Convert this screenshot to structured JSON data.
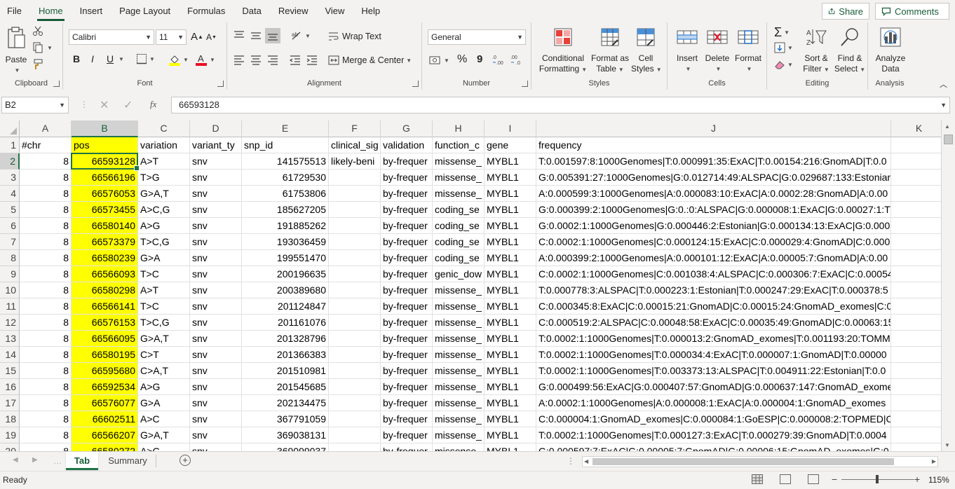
{
  "menu": {
    "tabs": [
      "File",
      "Home",
      "Insert",
      "Page Layout",
      "Formulas",
      "Data",
      "Review",
      "View",
      "Help"
    ],
    "active_tab": "Home",
    "share_label": "Share",
    "comments_label": "Comments"
  },
  "ribbon": {
    "clipboard": {
      "paste": "Paste",
      "label": "Clipboard"
    },
    "font": {
      "name": "Calibri",
      "size": "11",
      "bold": "B",
      "italic": "I",
      "underline": "U",
      "label": "Font"
    },
    "alignment": {
      "wrap_text": "Wrap Text",
      "merge_center": "Merge & Center",
      "label": "Alignment"
    },
    "number": {
      "format": "General",
      "percent": "%",
      "comma": "9",
      "label": "Number"
    },
    "styles": {
      "conditional_1": "Conditional",
      "conditional_2": "Formatting",
      "format_as_1": "Format as",
      "format_as_2": "Table",
      "cell_styles_1": "Cell",
      "cell_styles_2": "Styles",
      "label": "Styles"
    },
    "cells": {
      "insert": "Insert",
      "delete": "Delete",
      "format": "Format",
      "label": "Cells"
    },
    "editing": {
      "sort_1": "Sort &",
      "sort_2": "Filter",
      "find_1": "Find &",
      "find_2": "Select",
      "sigma": "Σ",
      "label": "Editing"
    },
    "analysis": {
      "analyze_1": "Analyze",
      "analyze_2": "Data",
      "label": "Analysis"
    }
  },
  "formula_bar": {
    "name_box": "B2",
    "fx": "fx",
    "value": "66593128"
  },
  "grid": {
    "columns": [
      "A",
      "B",
      "C",
      "D",
      "E",
      "F",
      "G",
      "H",
      "I",
      "J",
      "K"
    ],
    "selected_column": "B",
    "selected_row": "2",
    "rows": [
      {
        "n": "1",
        "cells": [
          "#chr",
          "pos",
          "variation",
          "variant_ty",
          "snp_id",
          "clinical_sig",
          "validation",
          "function_c",
          "gene",
          "frequency",
          ""
        ]
      },
      {
        "n": "2",
        "cells": [
          "8",
          "66593128",
          "A>T",
          "snv",
          "141575513",
          "likely-beni",
          "by-frequer",
          "missense_",
          "MYBL1",
          "T:0.001597:8:1000Genomes|T:0.000991:35:ExAC|T:0.00154:216:GnomAD|T:0.0",
          ""
        ]
      },
      {
        "n": "3",
        "cells": [
          "8",
          "66566196",
          "T>G",
          "snv",
          "61729530",
          "",
          "by-frequer",
          "missense_",
          "MYBL1",
          "G:0.005391:27:1000Genomes|G:0.012714:49:ALSPAC|G:0.029687:133:Estonian",
          ""
        ]
      },
      {
        "n": "4",
        "cells": [
          "8",
          "66576053",
          "G>A,T",
          "snv",
          "61753806",
          "",
          "by-frequer",
          "missense_",
          "MYBL1",
          "A:0.000599:3:1000Genomes|A:0.000083:10:ExAC|A:0.0002:28:GnomAD|A:0.00",
          ""
        ]
      },
      {
        "n": "5",
        "cells": [
          "8",
          "66573455",
          "A>C,G",
          "snv",
          "185627205",
          "",
          "by-frequer",
          "coding_se",
          "MYBL1",
          "G:0.000399:2:1000Genomes|G:0.:0:ALSPAC|G:0.000008:1:ExAC|G:0.00027:1:TV",
          ""
        ]
      },
      {
        "n": "6",
        "cells": [
          "8",
          "66580140",
          "A>G",
          "snv",
          "191885262",
          "",
          "by-frequer",
          "coding_se",
          "MYBL1",
          "G:0.0002:1:1000Genomes|G:0.000446:2:Estonian|G:0.000134:13:ExAC|G:0.000",
          ""
        ]
      },
      {
        "n": "7",
        "cells": [
          "8",
          "66573379",
          "T>C,G",
          "snv",
          "193036459",
          "",
          "by-frequer",
          "coding_se",
          "MYBL1",
          "C:0.0002:1:1000Genomes|C:0.000124:15:ExAC|C:0.000029:4:GnomAD|C:0.000",
          ""
        ]
      },
      {
        "n": "8",
        "cells": [
          "8",
          "66580239",
          "G>A",
          "snv",
          "199551470",
          "",
          "by-frequer",
          "coding_se",
          "MYBL1",
          "A:0.000399:2:1000Genomes|A:0.000101:12:ExAC|A:0.00005:7:GnomAD|A:0.00",
          ""
        ]
      },
      {
        "n": "9",
        "cells": [
          "8",
          "66566093",
          "T>C",
          "snv",
          "200196635",
          "",
          "by-frequer",
          "genic_dow",
          "MYBL1",
          "C:0.0002:1:1000Genomes|C:0.001038:4:ALSPAC|C:0.000306:7:ExAC|C:0.00054",
          ""
        ]
      },
      {
        "n": "10",
        "cells": [
          "8",
          "66580298",
          "A>T",
          "snv",
          "200389680",
          "",
          "by-frequer",
          "missense_",
          "MYBL1",
          "T:0.000778:3:ALSPAC|T:0.000223:1:Estonian|T:0.000247:29:ExAC|T:0.000378:5",
          ""
        ]
      },
      {
        "n": "11",
        "cells": [
          "8",
          "66566141",
          "T>C",
          "snv",
          "201124847",
          "",
          "by-frequer",
          "missense_",
          "MYBL1",
          "C:0.000345:8:ExAC|C:0.00015:21:GnomAD|C:0.00015:24:GnomAD_exomes|C:0.",
          ""
        ]
      },
      {
        "n": "12",
        "cells": [
          "8",
          "66576153",
          "T>C,G",
          "snv",
          "201161076",
          "",
          "by-frequer",
          "missense_",
          "MYBL1",
          "C:0.000519:2:ALSPAC|C:0.00048:58:ExAC|C:0.00035:49:GnomAD|C:0.00063:15",
          ""
        ]
      },
      {
        "n": "13",
        "cells": [
          "8",
          "66566095",
          "G>A,T",
          "snv",
          "201328796",
          "",
          "by-frequer",
          "missense_",
          "MYBL1",
          "T:0.0002:1:1000Genomes|T:0.000013:2:GnomAD_exomes|T:0.001193:20:TOMM",
          ""
        ]
      },
      {
        "n": "14",
        "cells": [
          "8",
          "66580195",
          "C>T",
          "snv",
          "201366383",
          "",
          "by-frequer",
          "missense_",
          "MYBL1",
          "T:0.0002:1:1000Genomes|T:0.000034:4:ExAC|T:0.000007:1:GnomAD|T:0.00000",
          ""
        ]
      },
      {
        "n": "15",
        "cells": [
          "8",
          "66595680",
          "C>A,T",
          "snv",
          "201510981",
          "",
          "by-frequer",
          "missense_",
          "MYBL1",
          "T:0.0002:1:1000Genomes|T:0.003373:13:ALSPAC|T:0.004911:22:Estonian|T:0.0",
          ""
        ]
      },
      {
        "n": "16",
        "cells": [
          "8",
          "66592534",
          "A>G",
          "snv",
          "201545685",
          "",
          "by-frequer",
          "missense_",
          "MYBL1",
          "G:0.000499:56:ExAC|G:0.000407:57:GnomAD|G:0.000637:147:GnomAD_exome",
          ""
        ]
      },
      {
        "n": "17",
        "cells": [
          "8",
          "66576077",
          "G>A",
          "snv",
          "202134475",
          "",
          "by-frequer",
          "missense_",
          "MYBL1",
          "A:0.0002:1:1000Genomes|A:0.000008:1:ExAC|A:0.000004:1:GnomAD_exomes",
          ""
        ]
      },
      {
        "n": "18",
        "cells": [
          "8",
          "66602511",
          "A>C",
          "snv",
          "367791059",
          "",
          "by-frequer",
          "missense_",
          "MYBL1",
          "C:0.000004:1:GnomAD_exomes|C:0.000084:1:GoESP|C:0.000008:2:TOPMED|C:0",
          ""
        ]
      },
      {
        "n": "19",
        "cells": [
          "8",
          "66566207",
          "G>A,T",
          "snv",
          "369038131",
          "",
          "by-frequer",
          "missense_",
          "MYBL1",
          "T:0.0002:1:1000Genomes|T:0.000127:3:ExAC|T:0.000279:39:GnomAD|T:0.0004",
          ""
        ]
      },
      {
        "n": "20",
        "cells": [
          "8",
          "66580272",
          "A>G",
          "snv",
          "369099037",
          "",
          "by-frequer",
          "missense_",
          "MYBL1",
          "G:0.000597:7:ExAC|G:0.00005:7:GnomAD|G:0.00006:15:GnomAD_exomes|G:0",
          ""
        ]
      }
    ]
  },
  "sheets": {
    "tabs": [
      "Tab",
      "Summary"
    ],
    "active": "Tab"
  },
  "status": {
    "ready": "Ready",
    "zoom": "115%"
  },
  "colors": {
    "accent": "#217346",
    "highlight": "#ffff00"
  }
}
